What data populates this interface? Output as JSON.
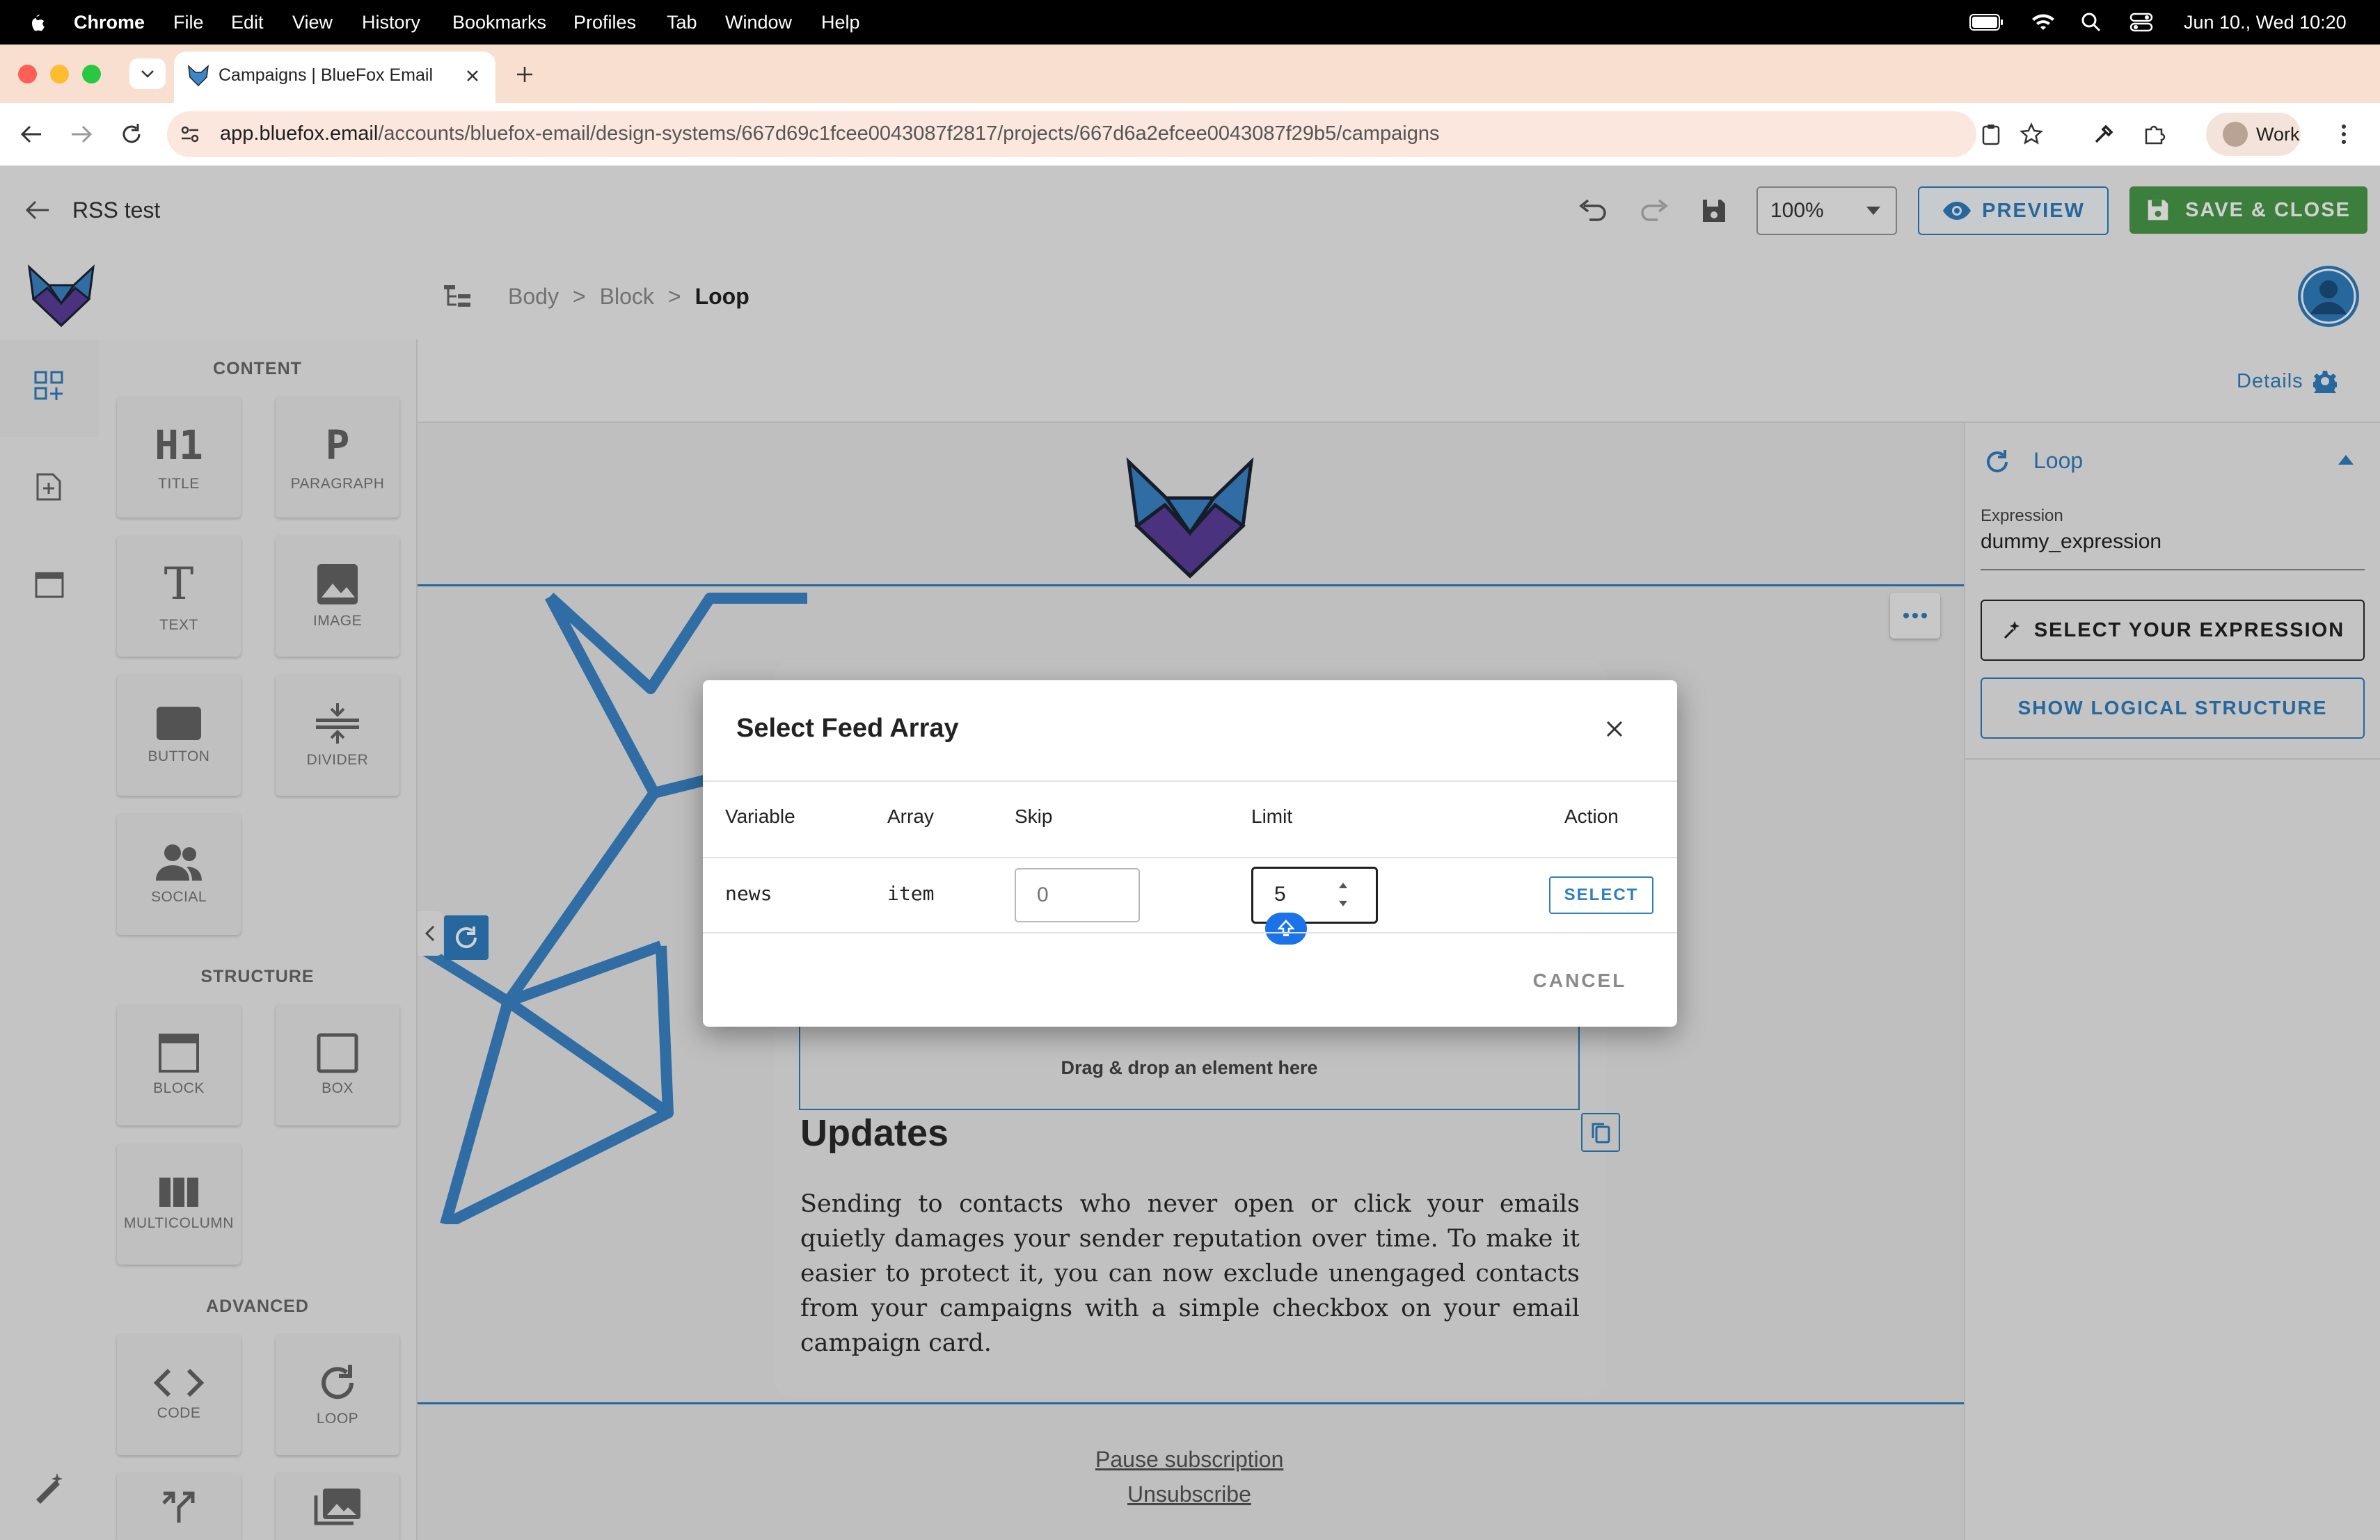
{
  "menubar": {
    "app": "Chrome",
    "items": [
      "File",
      "Edit",
      "View",
      "History",
      "Bookmarks",
      "Profiles",
      "Tab",
      "Window",
      "Help"
    ],
    "datetime": "Jun 10., Wed  10:20"
  },
  "browser": {
    "tab_title": "Campaigns | BlueFox Email",
    "url_host": "app.bluefox.email",
    "url_path": "/accounts/bluefox-email/design-systems/667d69c1fcee0043087f2817/projects/667d6a2efcee0043087f29b5/campaigns",
    "profile": "Work"
  },
  "header": {
    "title": "RSS test",
    "zoom": "100%",
    "preview": "PREVIEW",
    "save_close": "SAVE & CLOSE"
  },
  "breadcrumb": [
    "Body",
    "Block",
    "Loop"
  ],
  "sidebar": {
    "content_title": "CONTENT",
    "structure_title": "STRUCTURE",
    "advanced_title": "ADVANCED",
    "content_items": [
      {
        "icon": "H1",
        "label": "TITLE"
      },
      {
        "icon": "P",
        "label": "PARAGRAPH"
      },
      {
        "icon": "T",
        "label": "TEXT"
      },
      {
        "icon": "image-icon",
        "label": "IMAGE"
      },
      {
        "icon": "button-icon",
        "label": "BUTTON"
      },
      {
        "icon": "divider-icon",
        "label": "DIVIDER"
      },
      {
        "icon": "social-icon",
        "label": "SOCIAL"
      }
    ],
    "structure_items": [
      {
        "icon": "block-icon",
        "label": "BLOCK"
      },
      {
        "icon": "box-icon",
        "label": "BOX"
      },
      {
        "icon": "multicolumn-icon",
        "label": "MULTICOLUMN"
      }
    ],
    "advanced_items": [
      {
        "icon": "code-icon",
        "label": "CODE"
      },
      {
        "icon": "loop-icon",
        "label": "LOOP"
      }
    ]
  },
  "details": {
    "label": "Details",
    "section": "Loop",
    "expression_label": "Expression",
    "expression_value": "dummy_expression",
    "select_expression": "SELECT YOUR EXPRESSION",
    "show_logical": "SHOW LOGICAL STRUCTURE"
  },
  "email": {
    "drop_hint": "Drag & drop an element here",
    "heading": "Updates",
    "body": "Sending to contacts who never open or click your emails quietly damages your sender reputation over time. To make it easier to protect it, you can now exclude unengaged contacts from your campaigns with a simple checkbox on your email campaign card.",
    "pause": "Pause subscription",
    "unsubscribe": "Unsubscribe"
  },
  "dialog": {
    "title": "Select Feed Array",
    "columns": [
      "Variable",
      "Array",
      "Skip",
      "Limit",
      "Action"
    ],
    "row": {
      "variable": "news",
      "array": "item",
      "skip_placeholder": "0",
      "limit_value": "5",
      "action": "SELECT"
    },
    "cancel": "CANCEL"
  },
  "colors": {
    "accent": "#2f7fc1",
    "save_green": "#4a9a4a",
    "logo_blue": "#3a86c8",
    "logo_purple": "#5b3d9c"
  }
}
